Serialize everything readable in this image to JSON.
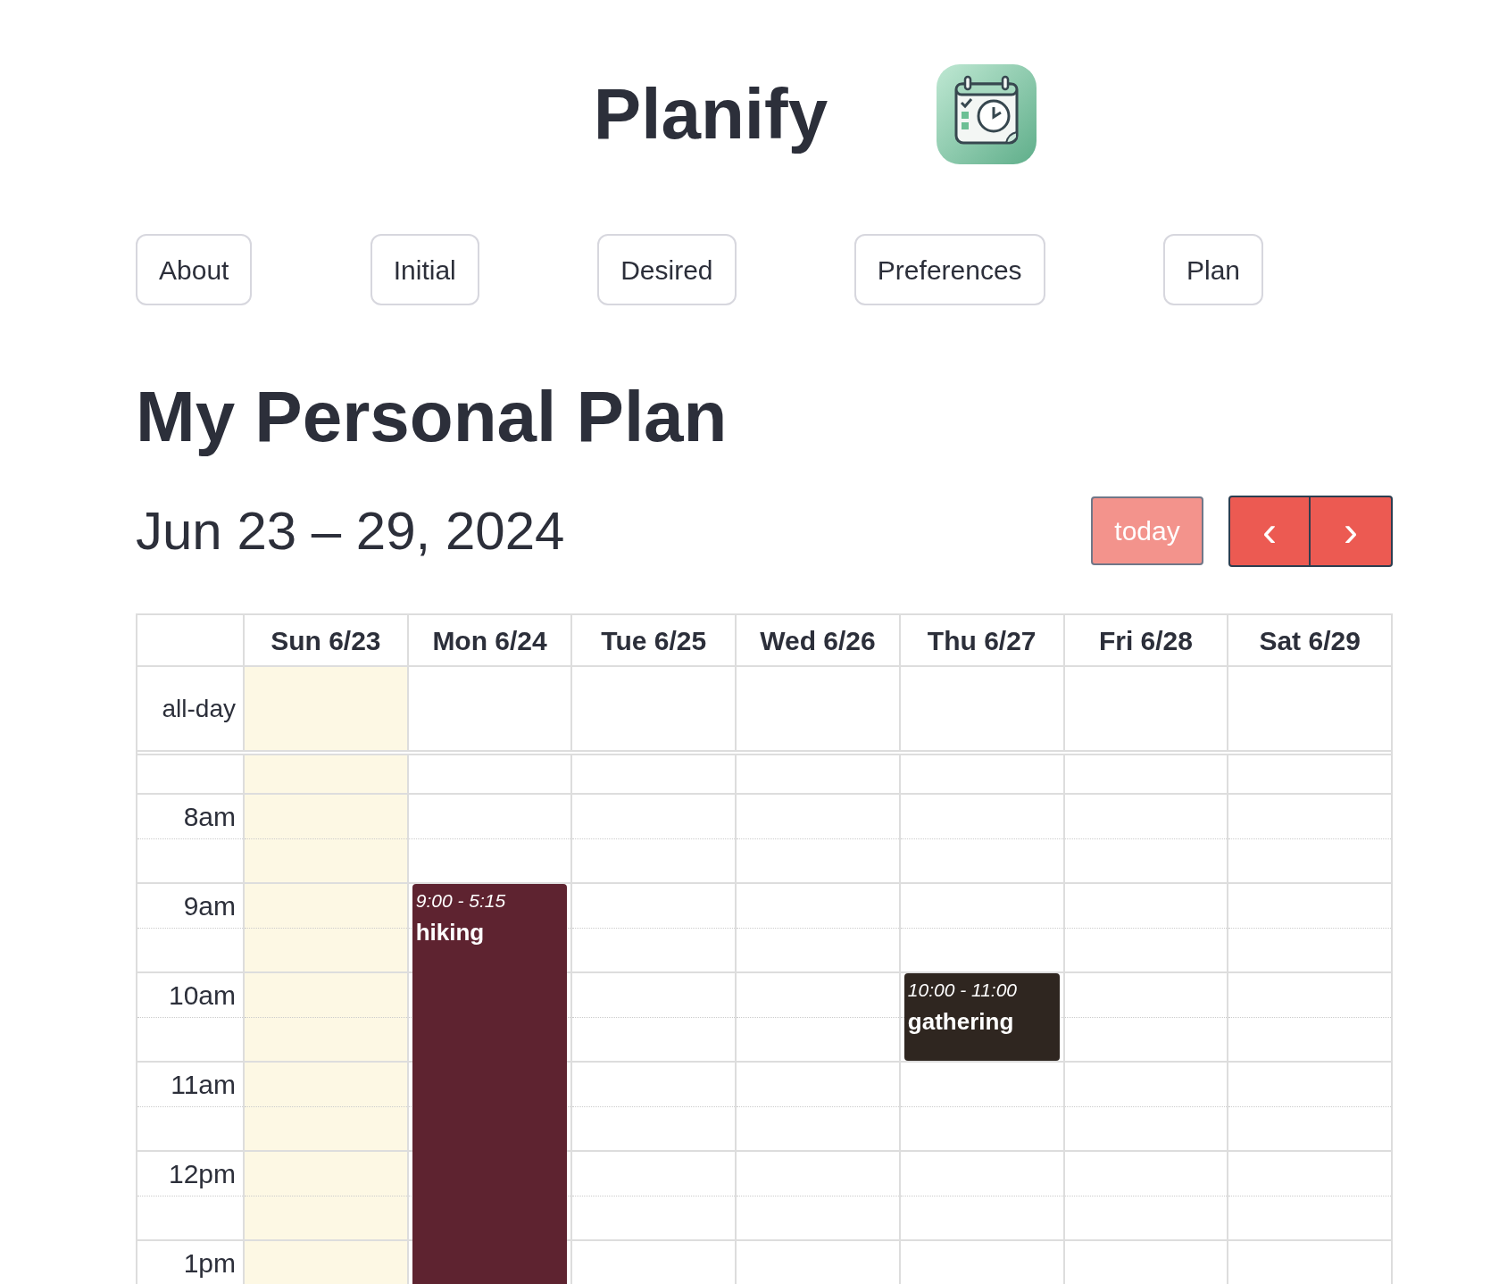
{
  "app": {
    "title": "Planify"
  },
  "nav": [
    {
      "label": "About"
    },
    {
      "label": "Initial"
    },
    {
      "label": "Desired"
    },
    {
      "label": "Preferences"
    },
    {
      "label": "Plan"
    }
  ],
  "heading": "My Personal Plan",
  "calendar": {
    "range": "Jun 23 – 29, 2024",
    "today_button": "today",
    "prev": "‹",
    "next": "›",
    "all_day_label": "all-day",
    "days": [
      {
        "label": "Sun 6/23",
        "today": true
      },
      {
        "label": "Mon 6/24",
        "today": false,
        "events": [
          {
            "time": "9:00 - 5:15",
            "title": "hiking",
            "color": "#5e2330"
          }
        ]
      },
      {
        "label": "Tue 6/25",
        "today": false
      },
      {
        "label": "Wed 6/26",
        "today": false
      },
      {
        "label": "Thu 6/27",
        "today": false,
        "events": [
          {
            "time": "10:00 - 11:00",
            "title": "gathering",
            "color": "#2f2620"
          }
        ]
      },
      {
        "label": "Fri 6/28",
        "today": false
      },
      {
        "label": "Sat 6/29",
        "today": false
      }
    ],
    "hours": [
      "8am",
      "9am",
      "10am",
      "11am",
      "12pm",
      "1pm"
    ]
  }
}
